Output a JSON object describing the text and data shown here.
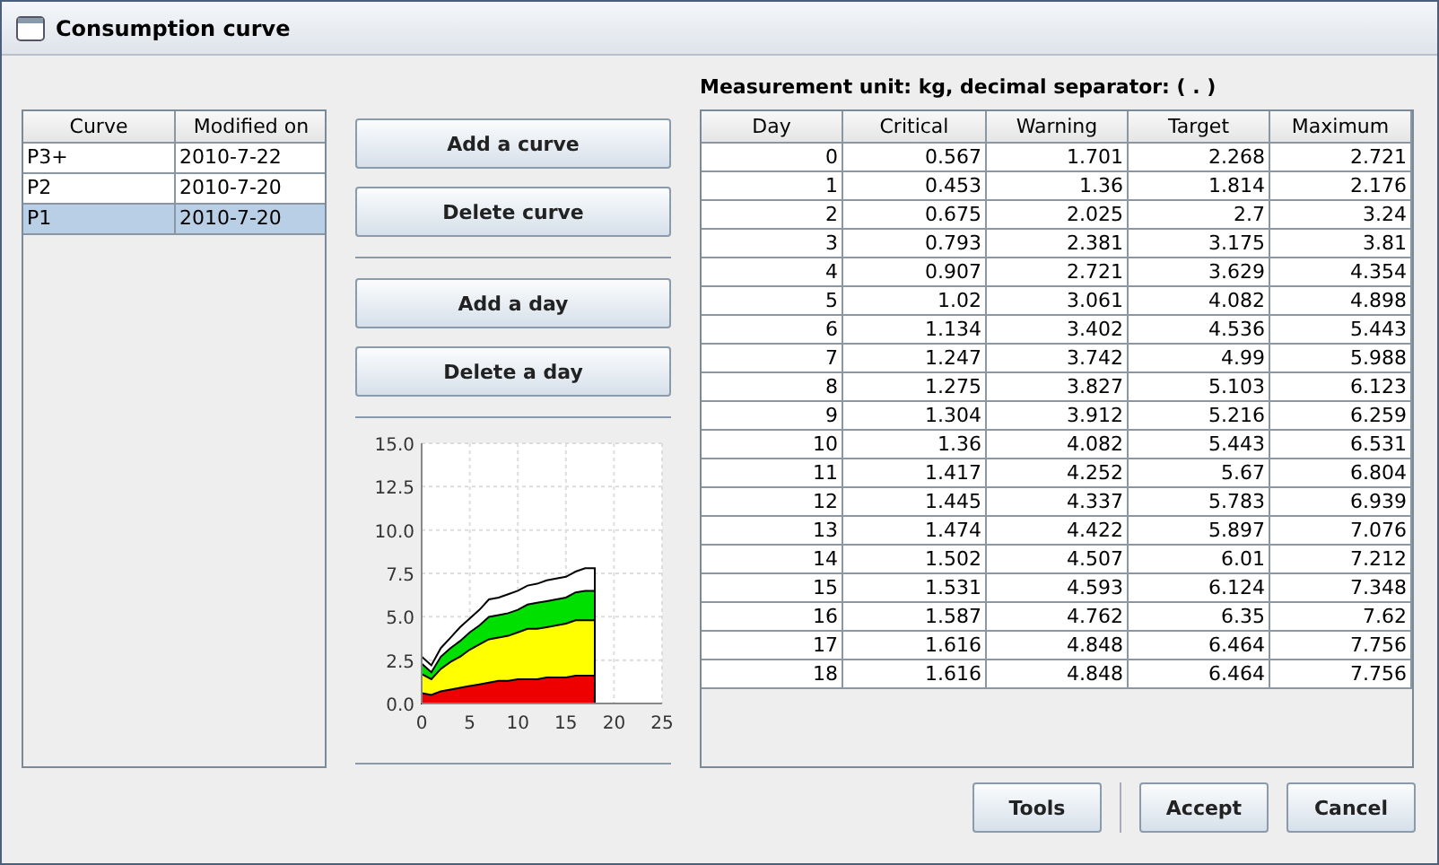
{
  "window": {
    "title": "Consumption curve"
  },
  "unit_label": "Measurement unit: kg, decimal separator: ( . )",
  "curves": {
    "columns": [
      "Curve",
      "Modified on"
    ],
    "rows": [
      {
        "cells": [
          "P3+",
          "2010-7-22"
        ],
        "selected": false
      },
      {
        "cells": [
          "P2",
          "2010-7-20"
        ],
        "selected": false
      },
      {
        "cells": [
          "P1",
          "2010-7-20"
        ],
        "selected": true
      }
    ]
  },
  "actions": [
    "Add a curve",
    "Delete curve",
    "Add a day",
    "Delete a day"
  ],
  "chart": {
    "chart_data": {
      "type": "area",
      "x": [
        0,
        1,
        2,
        3,
        4,
        5,
        6,
        7,
        8,
        9,
        10,
        11,
        12,
        13,
        14,
        15,
        16,
        17,
        18
      ],
      "xlim": [
        0,
        25
      ],
      "ylim": [
        0,
        15
      ],
      "xticks": [
        0,
        5,
        10,
        15,
        20,
        25
      ],
      "yticks": [
        {
          "value": 0,
          "label": "0.0"
        },
        {
          "value": 2.5,
          "label": "2.5"
        },
        {
          "value": 5,
          "label": "5.0"
        },
        {
          "value": 7.5,
          "label": "7.5"
        },
        {
          "value": 10,
          "label": "10.0"
        },
        {
          "value": 12.5,
          "label": "12.5"
        },
        {
          "value": 15,
          "label": "15.0"
        }
      ],
      "stacked": false,
      "grid": true,
      "series": [
        {
          "color": "#ffffff",
          "values": [
            2.7,
            2.2,
            3.2,
            3.8,
            4.4,
            4.9,
            5.4,
            6.0,
            6.1,
            6.3,
            6.5,
            6.8,
            6.9,
            7.1,
            7.2,
            7.3,
            7.6,
            7.8,
            7.8
          ]
        },
        {
          "color": "#00e000",
          "values": [
            2.3,
            1.8,
            2.7,
            3.2,
            3.6,
            4.1,
            4.5,
            5.0,
            5.1,
            5.2,
            5.4,
            5.7,
            5.8,
            5.9,
            6.0,
            6.1,
            6.4,
            6.5,
            6.5
          ]
        },
        {
          "color": "#ffff00",
          "values": [
            1.7,
            1.4,
            2.0,
            2.4,
            2.7,
            3.1,
            3.4,
            3.7,
            3.8,
            3.9,
            4.1,
            4.3,
            4.3,
            4.4,
            4.5,
            4.6,
            4.8,
            4.8,
            4.8
          ]
        },
        {
          "color": "#ee0000",
          "values": [
            0.6,
            0.5,
            0.7,
            0.8,
            0.9,
            1.0,
            1.1,
            1.2,
            1.3,
            1.3,
            1.4,
            1.4,
            1.4,
            1.5,
            1.5,
            1.5,
            1.6,
            1.6,
            1.6
          ]
        }
      ]
    }
  },
  "days": {
    "columns": [
      "Day",
      "Critical",
      "Warning",
      "Target",
      "Maximum"
    ],
    "rows": [
      [
        "0",
        "0.567",
        "1.701",
        "2.268",
        "2.721"
      ],
      [
        "1",
        "0.453",
        "1.36",
        "1.814",
        "2.176"
      ],
      [
        "2",
        "0.675",
        "2.025",
        "2.7",
        "3.24"
      ],
      [
        "3",
        "0.793",
        "2.381",
        "3.175",
        "3.81"
      ],
      [
        "4",
        "0.907",
        "2.721",
        "3.629",
        "4.354"
      ],
      [
        "5",
        "1.02",
        "3.061",
        "4.082",
        "4.898"
      ],
      [
        "6",
        "1.134",
        "3.402",
        "4.536",
        "5.443"
      ],
      [
        "7",
        "1.247",
        "3.742",
        "4.99",
        "5.988"
      ],
      [
        "8",
        "1.275",
        "3.827",
        "5.103",
        "6.123"
      ],
      [
        "9",
        "1.304",
        "3.912",
        "5.216",
        "6.259"
      ],
      [
        "10",
        "1.36",
        "4.082",
        "5.443",
        "6.531"
      ],
      [
        "11",
        "1.417",
        "4.252",
        "5.67",
        "6.804"
      ],
      [
        "12",
        "1.445",
        "4.337",
        "5.783",
        "6.939"
      ],
      [
        "13",
        "1.474",
        "4.422",
        "5.897",
        "7.076"
      ],
      [
        "14",
        "1.502",
        "4.507",
        "6.01",
        "7.212"
      ],
      [
        "15",
        "1.531",
        "4.593",
        "6.124",
        "7.348"
      ],
      [
        "16",
        "1.587",
        "4.762",
        "6.35",
        "7.62"
      ],
      [
        "17",
        "1.616",
        "4.848",
        "6.464",
        "7.756"
      ],
      [
        "18",
        "1.616",
        "4.848",
        "6.464",
        "7.756"
      ]
    ]
  },
  "footer_buttons": [
    "Tools",
    "Accept",
    "Cancel"
  ]
}
